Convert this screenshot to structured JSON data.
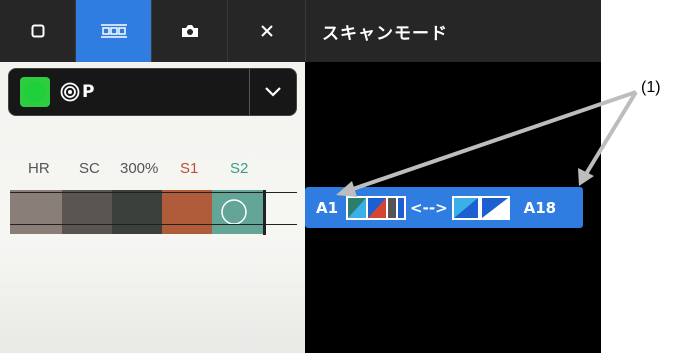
{
  "toolbar": {
    "buttons": [
      {
        "icon": "square-icon",
        "active": false
      },
      {
        "icon": "patch-strip-icon",
        "active": true
      },
      {
        "icon": "camera-icon",
        "active": false
      },
      {
        "icon": "close-icon",
        "active": false
      }
    ]
  },
  "header": {
    "title": "スキャンモード"
  },
  "mode_select": {
    "label": "P",
    "status_color": "#1fd03a"
  },
  "patch_labels": [
    "HR",
    "SC",
    "300%",
    "S1",
    "S2"
  ],
  "scan_bar": {
    "start": "A1",
    "separator": "<-->",
    "end": "A18"
  },
  "callout": {
    "label": "(1)"
  },
  "colors": {
    "accent": "#2f7de1",
    "s1_label": "#c0503a",
    "s2_label": "#3b9c8a"
  }
}
